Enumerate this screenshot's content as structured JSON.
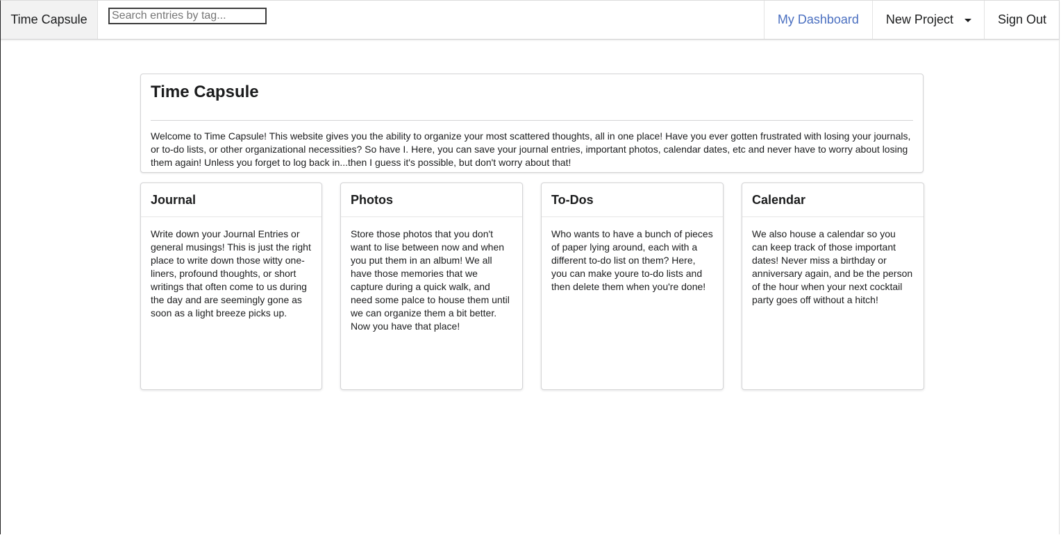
{
  "navbar": {
    "brand": "Time Capsule",
    "search_placeholder": "Search entries by tag...",
    "search_value": "",
    "dashboard_label": "My Dashboard",
    "new_project_label": "New Project",
    "sign_out_label": "Sign Out"
  },
  "hero": {
    "title": "Time Capsule",
    "description": "Welcome to Time Capsule! This website gives you the ability to organize your most scattered thoughts, all in one place! Have you ever gotten frustrated with losing your journals, or to-do lists, or other organizational necessities? So have I. Here, you can save your journal entries, important photos, calendar dates, etc and never have to worry about losing them again! Unless you forget to log back in...then I guess it's possible, but don't worry about that!"
  },
  "cards": [
    {
      "title": "Journal",
      "body": "Write down your Journal Entries or general musings! This is just the right place to write down those witty one-liners, profound thoughts, or short writings that often come to us during the day and are seemingly gone as soon as a light breeze picks up."
    },
    {
      "title": "Photos",
      "body": "Store those photos that you don't want to lise between now and when you put them in an album! We all have those memories that we capture during a quick walk, and need some palce to house them until we can organize them a bit better. Now you have that place!"
    },
    {
      "title": "To-Dos",
      "body": "Who wants to have a bunch of pieces of paper lying around, each with a different to-do list on them? Here, you can make youre to-do lists and then delete them when you're done!"
    },
    {
      "title": "Calendar",
      "body": "We also house a calendar so you can keep track of those important dates! Never miss a birthday or anniversary again, and be the person of the hour when your next cocktail party goes off without a hitch!"
    }
  ],
  "colors": {
    "active_link": "#4a6fc0",
    "border": "#d4d4d5"
  },
  "icons": {
    "new_project_dropdown": "caret-down-icon"
  }
}
